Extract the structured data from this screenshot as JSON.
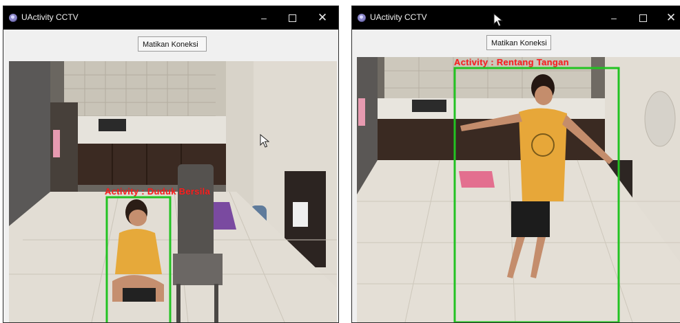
{
  "windows": [
    {
      "title": "UActivity CCTV",
      "icon": "app-icon",
      "controls": {
        "minimize": "–",
        "maximize": "☐",
        "close": "✕"
      },
      "button_label": "Matikan Koneksi",
      "activity_label": "Activity : Duduk Bersila"
    },
    {
      "title": "UActivity CCTV",
      "icon": "app-icon",
      "controls": {
        "minimize": "–",
        "maximize": "☐",
        "close": "✕"
      },
      "button_label": "Matikan Koneksi",
      "activity_label": "Activity : Rentang Tangan"
    }
  ],
  "colors": {
    "titlebar": "#000000",
    "detection_box": "#22c322",
    "activity_text": "#ff1e1e"
  }
}
